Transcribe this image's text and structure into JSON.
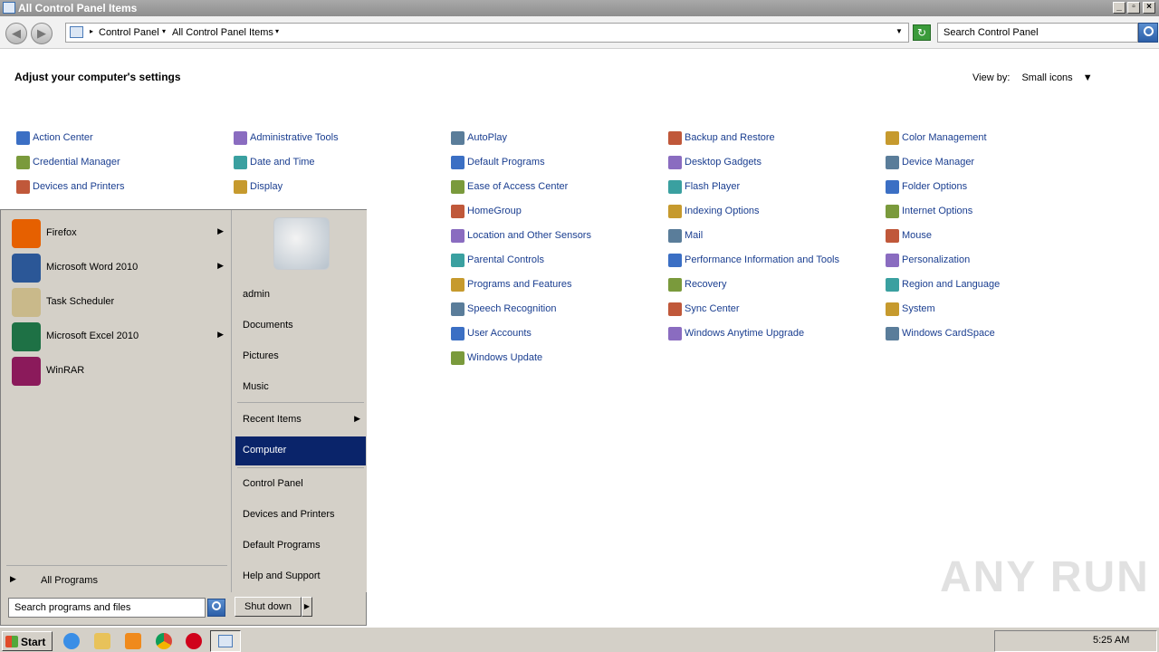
{
  "window": {
    "title": "All Control Panel Items"
  },
  "address": {
    "crumbs": [
      "Control Panel",
      "All Control Panel Items"
    ],
    "search_placeholder": "Search Control Panel"
  },
  "content": {
    "heading": "Adjust your computer's settings",
    "view_by_label": "View by:",
    "view_by_value": "Small icons",
    "columns": [
      [
        "Action Center",
        "Credential Manager",
        "Devices and Printers"
      ],
      [
        "Administrative Tools",
        "Date and Time",
        "Display"
      ],
      [
        "AutoPlay",
        "Default Programs",
        "Ease of Access Center",
        "HomeGroup",
        "Location and Other Sensors",
        "Parental Controls",
        "Programs and Features",
        "Speech Recognition",
        "User Accounts",
        "Windows Update"
      ],
      [
        "Backup and Restore",
        "Desktop Gadgets",
        "Flash Player",
        "Indexing Options",
        "Mail",
        "Performance Information and Tools",
        "Recovery",
        "Sync Center",
        "Windows Anytime Upgrade"
      ],
      [
        "Color Management",
        "Device Manager",
        "Folder Options",
        "Internet Options",
        "Mouse",
        "Personalization",
        "Region and Language",
        "System",
        "Windows CardSpace"
      ]
    ]
  },
  "start_menu": {
    "programs": [
      {
        "label": "Firefox",
        "has_arrow": true,
        "icon": "firefox-icon",
        "color": "#e66000"
      },
      {
        "label": "Microsoft Word 2010",
        "has_arrow": true,
        "icon": "word-icon",
        "color": "#2b5797"
      },
      {
        "label": "Task Scheduler",
        "has_arrow": false,
        "icon": "clock-icon",
        "color": "#c9b98a"
      },
      {
        "label": "Microsoft Excel 2010",
        "has_arrow": true,
        "icon": "excel-icon",
        "color": "#1e7145"
      },
      {
        "label": "WinRAR",
        "has_arrow": false,
        "icon": "winrar-icon",
        "color": "#8b1a5b"
      }
    ],
    "all_programs": "All Programs",
    "search_placeholder": "Search programs and files",
    "right_links": [
      "admin",
      "Documents",
      "Pictures",
      "Music",
      "Recent Items",
      "Computer",
      "Control Panel",
      "Devices and Printers",
      "Default Programs",
      "Help and Support"
    ],
    "selected": "Computer",
    "shutdown": "Shut down"
  },
  "taskbar": {
    "start_label": "Start",
    "clock": "5:25 AM"
  },
  "watermark": "ANY RUN"
}
